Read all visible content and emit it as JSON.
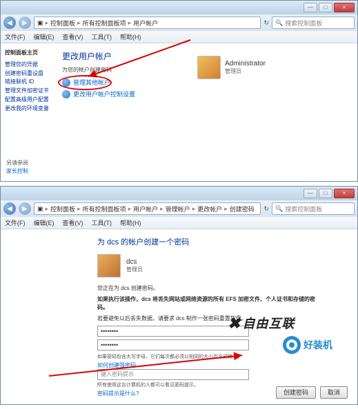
{
  "win1": {
    "titlebar_buttons": [
      "—",
      "□",
      "×"
    ],
    "breadcrumb": [
      "控制面板",
      "所有控制面板项",
      "用户帐户"
    ],
    "search_placeholder": "搜索控制面板",
    "menus": [
      "文件(F)",
      "编辑(E)",
      "查看(V)",
      "工具(T)",
      "帮助(H)"
    ],
    "side_header": "控制面板主页",
    "side_items": [
      "管理您的凭据",
      "创建密码重设盘",
      "链接联机 ID",
      "管理文件加密证书",
      "配置高级用户配置文件属性",
      "更改我的环境变量"
    ],
    "seealso_header": "另请参阅",
    "seealso_item": "家长控制",
    "heading": "更改用户帐户",
    "subheading": "为您的帐户创建密码",
    "link_circled": "管理其他帐户",
    "link_uac": "更改用户帐户控制设置",
    "account_name": "Administrator",
    "account_type": "管理员"
  },
  "win2": {
    "titlebar_buttons": [
      "—",
      "□",
      "×"
    ],
    "breadcrumb": [
      "控制面板",
      "所有控制面板项",
      "用户帐户",
      "管理帐户",
      "更改帐户",
      "创建密码"
    ],
    "search_placeholder": "搜索控制面板",
    "menus": [
      "文件(F)",
      "编辑(E)",
      "查看(V)",
      "工具(T)",
      "帮助(H)"
    ],
    "page_title": "为 dcs 的帐户创建一个密码",
    "user_name": "dcs",
    "user_type": "管理员",
    "intro": "您正在为 dcs 创建密码。",
    "warn": "如果执行该操作，dcs 将丢失网站或网络资源的所有 EFS 加密文件、个人证书和存储的密码。",
    "tip": "若要避免以后丢失数据，请要求 dcs 制作一张密码重置软盘。",
    "pw_mask": "••••••••",
    "hint_note1": "如果密码包含大写字母，它们每次都必须以相同的大小写方式输入。",
    "hint_link": "如何创建强密码",
    "hint_placeholder": "键入密码提示",
    "hint_note2": "所有使用这台计算机的人都可以看见密码提示。",
    "hint_link2": "密码提示是什么?",
    "btn_create": "创建密码",
    "btn_cancel": "取消"
  },
  "watermark1": "自由互联",
  "watermark2": "好装机"
}
